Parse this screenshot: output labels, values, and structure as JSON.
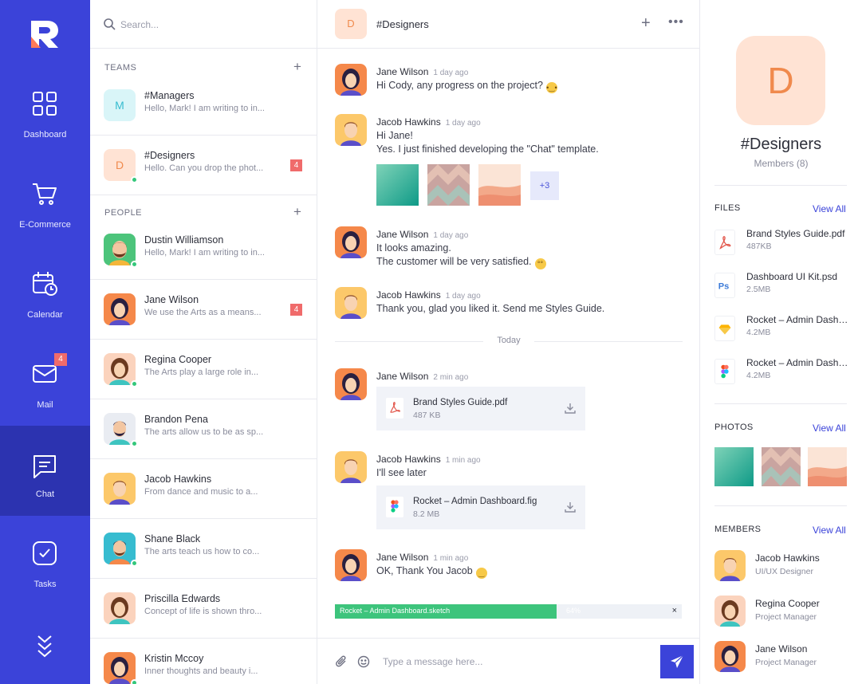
{
  "nav": {
    "items": [
      {
        "label": "Dashboard",
        "icon": "dashboard-icon"
      },
      {
        "label": "E-Commerce",
        "icon": "cart-icon"
      },
      {
        "label": "Calendar",
        "icon": "calendar-icon"
      },
      {
        "label": "Mail",
        "icon": "mail-icon",
        "badge": "4"
      },
      {
        "label": "Chat",
        "icon": "chat-icon",
        "active": true
      },
      {
        "label": "Tasks",
        "icon": "tasks-icon"
      }
    ],
    "accent": "#3b43d9"
  },
  "search": {
    "placeholder": "Search..."
  },
  "teams": {
    "title": "TEAMS",
    "items": [
      {
        "avatar": "M",
        "name": "#Managers",
        "preview": "Hello, Mark! I am writing to in..."
      },
      {
        "avatar": "D",
        "name": "#Designers",
        "preview": "Hello. Can you drop the phot...",
        "count": "4"
      }
    ]
  },
  "people": {
    "title": "PEOPLE",
    "items": [
      {
        "name": "Dustin Williamson",
        "preview": "Hello, Mark! I am writing to in..."
      },
      {
        "name": "Jane Wilson",
        "preview": "We use the Arts as a means...",
        "count": "4"
      },
      {
        "name": "Regina Cooper",
        "preview": "The Arts play a large role in..."
      },
      {
        "name": "Brandon Pena",
        "preview": "The arts allow us to be as sp..."
      },
      {
        "name": "Jacob Hawkins",
        "preview": "From dance and music to a..."
      },
      {
        "name": "Shane Black",
        "preview": "The arts teach us how to co..."
      },
      {
        "name": "Priscilla Edwards",
        "preview": "Concept of life is shown thro..."
      },
      {
        "name": "Kristin Mccoy",
        "preview": "Inner thoughts and beauty i..."
      }
    ]
  },
  "chat": {
    "avatar": "D",
    "title": "#Designers",
    "messages": [
      {
        "author": "Jane Wilson",
        "time": "1 day ago",
        "lines": [
          "Hi Cody, any progress on the project?"
        ]
      },
      {
        "author": "Jacob Hawkins",
        "time": "1 day ago",
        "lines": [
          "Hi Jane!",
          "Yes. I just finished developing the \"Chat\" template."
        ],
        "more_photos": "+3"
      },
      {
        "author": "Jane Wilson",
        "time": "1 day ago",
        "lines": [
          "It looks amazing.",
          "The customer will be very satisfied."
        ]
      },
      {
        "author": "Jacob Hawkins",
        "time": "1 day ago",
        "lines": [
          "Thank you, glad you liked it. Send me Styles Guide."
        ]
      },
      {
        "author": "Jane Wilson",
        "time": "2 min ago",
        "file": {
          "name": "Brand Styles Guide.pdf",
          "size": "487 KB"
        }
      },
      {
        "author": "Jacob Hawkins",
        "time": "1 min ago",
        "lines": [
          "I'll see later"
        ],
        "file": {
          "name": "Rocket – Admin Dashboard.fig",
          "size": "8.2 MB"
        }
      },
      {
        "author": "Jane Wilson",
        "time": "1 min ago",
        "lines": [
          "OK, Thank You Jacob"
        ]
      }
    ],
    "divider": "Today",
    "upload": {
      "name": "Rocket – Admin Dashboard.sketch",
      "percent_label": "64%",
      "progress": 0.64
    },
    "composer_placeholder": "Type a message here..."
  },
  "info": {
    "avatar": "D",
    "name": "#Designers",
    "members_label": "Members (8)",
    "files_title": "FILES",
    "photos_title": "PHOTOS",
    "members_title": "MEMBERS",
    "view_all": "View All",
    "files": [
      {
        "name": "Brand Styles Guide.pdf",
        "size": "487KB",
        "icon": "pdf-icon"
      },
      {
        "name": "Dashboard UI Kit.psd",
        "size": "2.5MB",
        "icon": "photoshop-icon"
      },
      {
        "name": "Rocket – Admin Dashboard.sketch",
        "size": "4.2MB",
        "icon": "sketch-icon"
      },
      {
        "name": "Rocket – Admin Dashboard.fig",
        "size": "4.2MB",
        "icon": "figma-icon"
      }
    ],
    "members": [
      {
        "name": "Jacob Hawkins",
        "role": "UI/UX Designer"
      },
      {
        "name": "Regina Cooper",
        "role": "Project Manager"
      },
      {
        "name": "Jane Wilson",
        "role": "Project Manager"
      }
    ]
  }
}
